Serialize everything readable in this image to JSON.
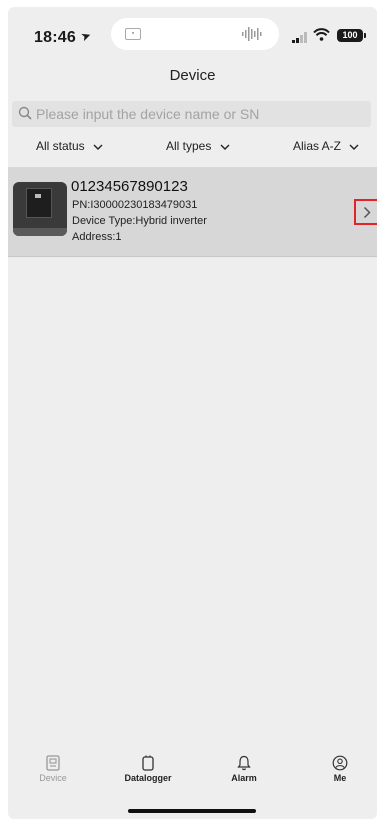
{
  "status_bar": {
    "time": "18:46",
    "battery": "100",
    "icons": [
      "location-arrow-icon",
      "signal-icon",
      "wifi-icon",
      "battery-icon"
    ]
  },
  "header": {
    "title": "Device"
  },
  "search": {
    "placeholder": "Please input the device name or SN",
    "value": ""
  },
  "filters": {
    "status": "All status",
    "types": "All types",
    "sort": "Alias A-Z"
  },
  "devices": [
    {
      "sn": "01234567890123",
      "pn": "PN:I30000230183479031",
      "type": "Device Type:Hybrid inverter",
      "address": "Address:1"
    }
  ],
  "tabs": [
    {
      "label": "Device",
      "icon": "device-icon"
    },
    {
      "label": "Datalogger",
      "icon": "datalogger-icon"
    },
    {
      "label": "Alarm",
      "icon": "bell-icon"
    },
    {
      "label": "Me",
      "icon": "user-icon"
    }
  ],
  "colors": {
    "background": "#eeeeee",
    "card": "#d7d7d7",
    "highlight": "#e0242a"
  }
}
